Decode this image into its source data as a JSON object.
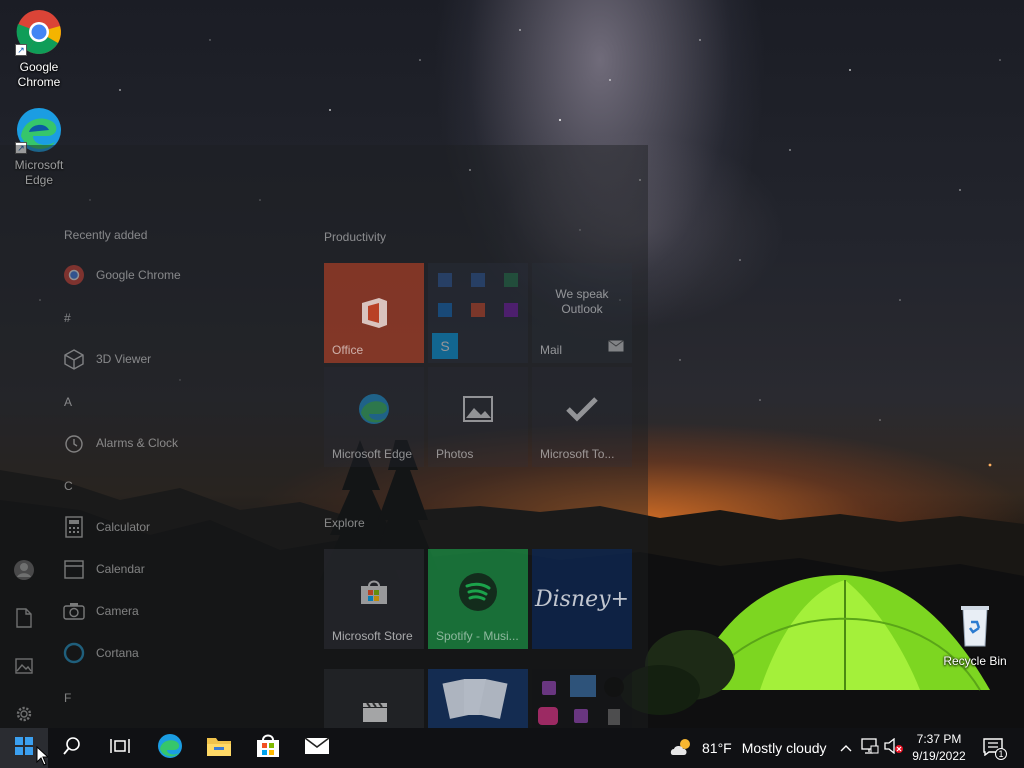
{
  "desktop": {
    "icons": [
      {
        "label": "Google Chrome",
        "icon": "chrome-icon"
      },
      {
        "label": "Microsoft Edge",
        "icon": "edge-icon"
      },
      {
        "label": "Recycle Bin",
        "icon": "recycle-bin-icon"
      }
    ]
  },
  "start_menu": {
    "rail": [
      "user-icon",
      "documents-icon",
      "pictures-icon",
      "settings-icon"
    ],
    "app_list": {
      "recently_added_header": "Recently added",
      "items": [
        {
          "type": "app",
          "label": "Google Chrome",
          "icon": "chrome-icon"
        },
        {
          "type": "letter",
          "label": "#"
        },
        {
          "type": "app",
          "label": "3D Viewer",
          "icon": "cube-icon"
        },
        {
          "type": "letter",
          "label": "A"
        },
        {
          "type": "app",
          "label": "Alarms & Clock",
          "icon": "alarm-clock-icon"
        },
        {
          "type": "letter",
          "label": "C"
        },
        {
          "type": "app",
          "label": "Calculator",
          "icon": "calculator-icon"
        },
        {
          "type": "app",
          "label": "Calendar",
          "icon": "calendar-icon"
        },
        {
          "type": "app",
          "label": "Camera",
          "icon": "camera-icon"
        },
        {
          "type": "app",
          "label": "Cortana",
          "icon": "cortana-icon"
        },
        {
          "type": "letter",
          "label": "F"
        }
      ]
    },
    "groups": [
      {
        "title": "Productivity",
        "tiles": [
          {
            "label": "Office",
            "color": "#d24726"
          },
          {
            "label": "",
            "color": "#2b3240"
          },
          {
            "label": "Mail",
            "color": "#2b3240",
            "caption": "We speak Outlook"
          },
          {
            "label": "Microsoft Edge",
            "color": "#2b3240"
          },
          {
            "label": "Photos",
            "color": "#2b3240"
          },
          {
            "label": "Microsoft To...",
            "color": "#2b3240"
          }
        ]
      },
      {
        "title": "Explore",
        "tiles": [
          {
            "label": "Microsoft Store",
            "color": "#2b2d33"
          },
          {
            "label": "Spotify - Musi...",
            "color": "#1db954"
          },
          {
            "label": "Disney+",
            "color": "#0b2a5c"
          }
        ]
      }
    ]
  },
  "taskbar": {
    "buttons": [
      "windows-start-icon",
      "search-icon",
      "task-view-icon",
      "edge-icon",
      "file-explorer-icon",
      "store-icon",
      "mail-icon"
    ],
    "weather": {
      "temp": "81°F",
      "condition": "Mostly cloudy"
    },
    "tray_icons": [
      "chevron-up-icon",
      "network-icon",
      "volume-muted-icon"
    ],
    "clock": {
      "time": "7:37 PM",
      "date": "9/19/2022"
    },
    "notifications": {
      "count": "1"
    }
  }
}
